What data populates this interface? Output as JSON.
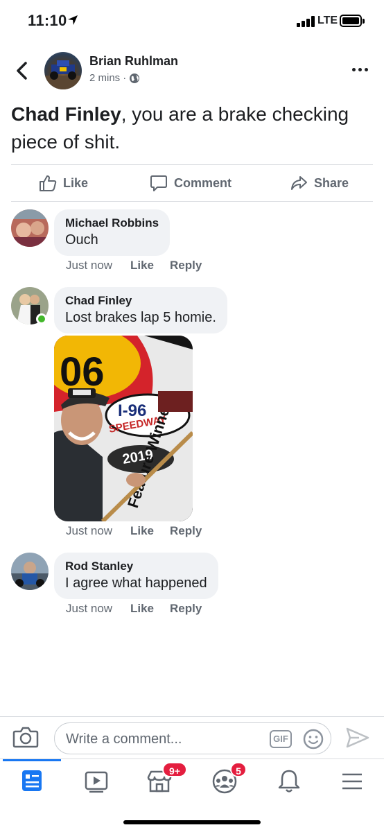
{
  "status_bar": {
    "time": "11:10",
    "network": "LTE"
  },
  "post": {
    "author": "Brian Ruhlman",
    "time": "2 mins",
    "separator": "·",
    "text_mention": "Chad Finley",
    "text_body": ", you are a brake checking piece of shit."
  },
  "actions": {
    "like": "Like",
    "comment": "Comment",
    "share": "Share"
  },
  "comments": [
    {
      "name": "Michael Robbins",
      "text": "Ouch",
      "time": "Just now",
      "like": "Like",
      "reply": "Reply"
    },
    {
      "name": "Chad Finley",
      "text": "Lost brakes lap 5 homie.",
      "time": "Just now",
      "like": "Like",
      "reply": "Reply"
    },
    {
      "name": "Rod Stanley",
      "text": "I agree what happened",
      "time": "Just now",
      "like": "Like",
      "reply": "Reply"
    }
  ],
  "photo": {
    "number": "06",
    "speedway_top": "I-96",
    "speedway": "SPEEDWAY",
    "year": "2019",
    "banner": "Feature Winner"
  },
  "composer": {
    "placeholder": "Write a comment...",
    "gif_label": "GIF"
  },
  "tab_bar": {
    "tabs": [
      "news-feed",
      "watch",
      "marketplace",
      "groups",
      "notifications",
      "menu"
    ],
    "marketplace_badge": "9+",
    "groups_badge": "5"
  },
  "colors": {
    "accent": "#1877f2",
    "badge": "#e41e3f",
    "online": "#42b72a"
  }
}
